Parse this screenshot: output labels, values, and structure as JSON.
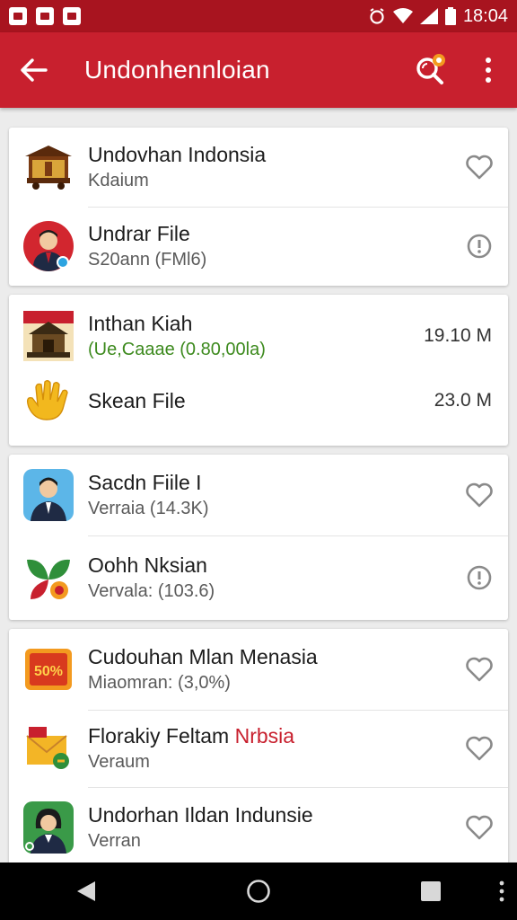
{
  "status_bar": {
    "time": "18:04"
  },
  "app_bar": {
    "title": "Undonhennloian"
  },
  "cards": [
    {
      "items": [
        {
          "title": "Undovhan Indonsia",
          "subtitle": "Kdaium",
          "action": "heart-icon"
        },
        {
          "title": "Undrar File",
          "subtitle": "S20ann (FMl6)",
          "action": "info-icon"
        }
      ]
    },
    {
      "items": [
        {
          "title": "Inthan Kiah",
          "subtitle": "(Ue,Caaae (0.80,00la)",
          "size": "19.10 M"
        },
        {
          "title": "Skean File",
          "size": "23.0 M"
        }
      ]
    },
    {
      "items": [
        {
          "title": "Sacdn Fiile I",
          "subtitle": "Verraia (14.3K)",
          "action": "heart-icon"
        },
        {
          "title": "Oohh Nksian",
          "subtitle": "Vervala: (103.6)",
          "action": "info-icon"
        }
      ]
    },
    {
      "items": [
        {
          "title": "Cudouhan Mlan Menasia",
          "subtitle": "Miaomran: (3,0%)",
          "action": "heart-icon"
        },
        {
          "title": "Florakiy Feltam",
          "title_red": "Nrbsia",
          "subtitle": "Veraum",
          "action": "heart-icon"
        },
        {
          "title": "Undorhan Ildan Indunsie",
          "subtitle": "Verran",
          "action": "heart-icon"
        }
      ]
    }
  ],
  "badge_50": "50%",
  "colors": {
    "status_bar": "#a8141f",
    "app_bar": "#c8202e",
    "accent_orange": "#f39a1f",
    "green_text": "#3d8a1e"
  }
}
